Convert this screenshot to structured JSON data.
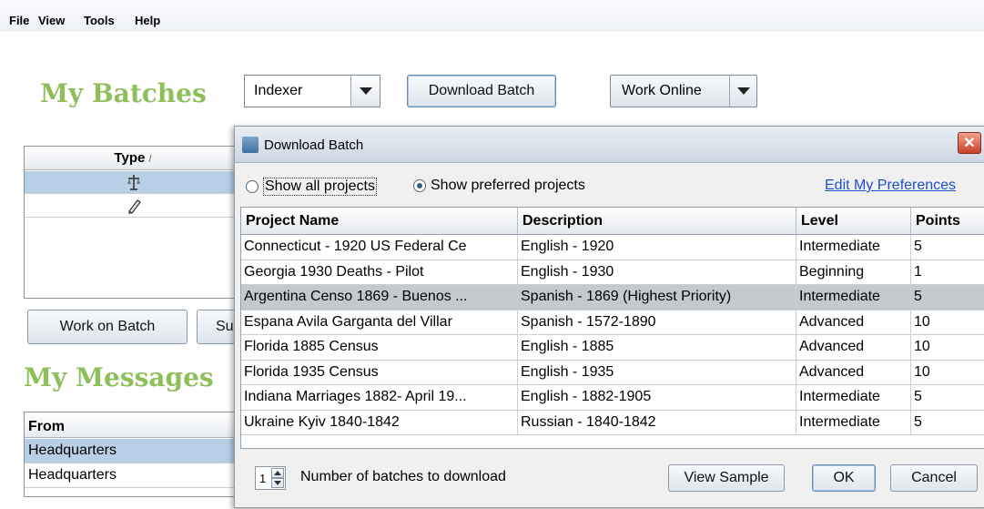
{
  "menu": {
    "file": "File",
    "view": "View",
    "tools": "Tools",
    "help": "Help"
  },
  "main": {
    "my_batches_title": "My Batches",
    "role_select": "Indexer",
    "download_batch_button": "Download Batch",
    "work_online_button": "Work Online",
    "type_header": "Type",
    "sort_indicator": "/",
    "type_rows": [
      {
        "icon": "scale-icon",
        "selected": true
      },
      {
        "icon": "pencil-icon",
        "selected": false
      }
    ],
    "work_on_batch_button": "Work on Batch",
    "submit_button_partial": "Su",
    "my_messages_title": "My Messages",
    "messages_from_header": "From",
    "messages": [
      "Headquarters",
      "Headquarters"
    ]
  },
  "dialog": {
    "title": "Download Batch",
    "radio_all": "Show all projects",
    "radio_preferred": "Show preferred projects",
    "preferred_selected": true,
    "edit_preferences_link": "Edit My Preferences",
    "columns": [
      "Project Name",
      "Description",
      "Level",
      "Points"
    ],
    "rows": [
      {
        "name": "Connecticut - 1920 US Federal Ce",
        "description": "English - 1920",
        "level": "Intermediate",
        "points": "5"
      },
      {
        "name": "Georgia 1930 Deaths - Pilot",
        "description": "English - 1930",
        "level": "Beginning",
        "points": "1"
      },
      {
        "name": "Argentina Censo 1869 - Buenos ...",
        "description": "Spanish - 1869 (Highest Priority)",
        "level": "Intermediate",
        "points": "5",
        "selected": true
      },
      {
        "name": "Espana Avila Garganta del Villar",
        "description": "Spanish - 1572-1890",
        "level": "Advanced",
        "points": "10"
      },
      {
        "name": "Florida 1885 Census",
        "description": "English - 1885",
        "level": "Advanced",
        "points": "10"
      },
      {
        "name": "Florida 1935 Census",
        "description": "English - 1935",
        "level": "Advanced",
        "points": "10"
      },
      {
        "name": "Indiana Marriages 1882- April 19...",
        "description": "English - 1882-1905",
        "level": "Intermediate",
        "points": "5"
      },
      {
        "name": "Ukraine Kyiv 1840-1842",
        "description": "Russian - 1840-1842",
        "level": "Intermediate",
        "points": "5"
      }
    ],
    "batch_count": "1",
    "batch_count_label": "Number of batches to download",
    "view_sample_button": "View Sample",
    "ok_button": "OK",
    "cancel_button": "Cancel"
  },
  "colors": {
    "title_green": "#8fbf5a",
    "selection_blue": "#b9cfe6",
    "selected_row_gray": "#c5c9ce",
    "link_blue": "#1f4fd0"
  }
}
